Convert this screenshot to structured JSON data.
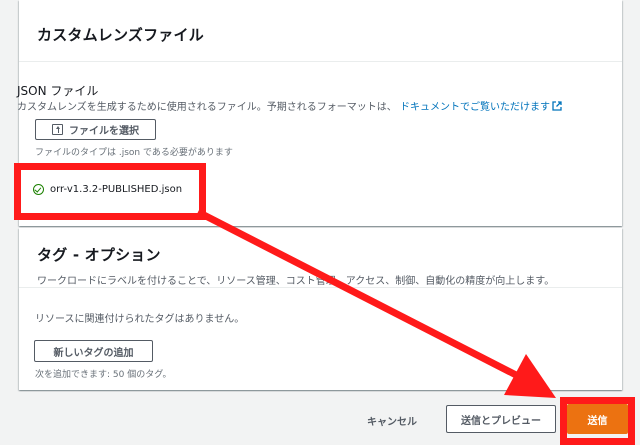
{
  "custom_lens_panel": {
    "title": "カスタムレンズファイル",
    "json_label": "JSON ファイル",
    "json_description": "カスタムレンズを生成するために使用されるファイル。予期されるフォーマットは、",
    "docs_link": "ドキュメントでご覧いただけます",
    "choose_file_button": "ファイルを選択",
    "file_type_hint": "ファイルのタイプは .json である必要があります",
    "uploaded_file": "orr-v1.3.2-PUBLISHED.json"
  },
  "tags_panel": {
    "title": "タグ - オプション",
    "description": "ワークロードにラベルを付けることで、リソース管理、コスト管理、アクセス、制御、自動化の精度が向上します。",
    "empty_message": "リソースに関連付けられたタグはありません。",
    "add_tag_button": "新しいタグの追加",
    "limit_hint": "次を追加できます: 50 個のタグ。"
  },
  "footer": {
    "cancel_label": "キャンセル",
    "preview_label": "送信とプレビュー",
    "submit_label": "送信"
  },
  "colors": {
    "annotation_red": "#ff1a1a",
    "primary_orange": "#ec7211",
    "link_blue": "#0073bb",
    "success_green": "#1d8102"
  }
}
